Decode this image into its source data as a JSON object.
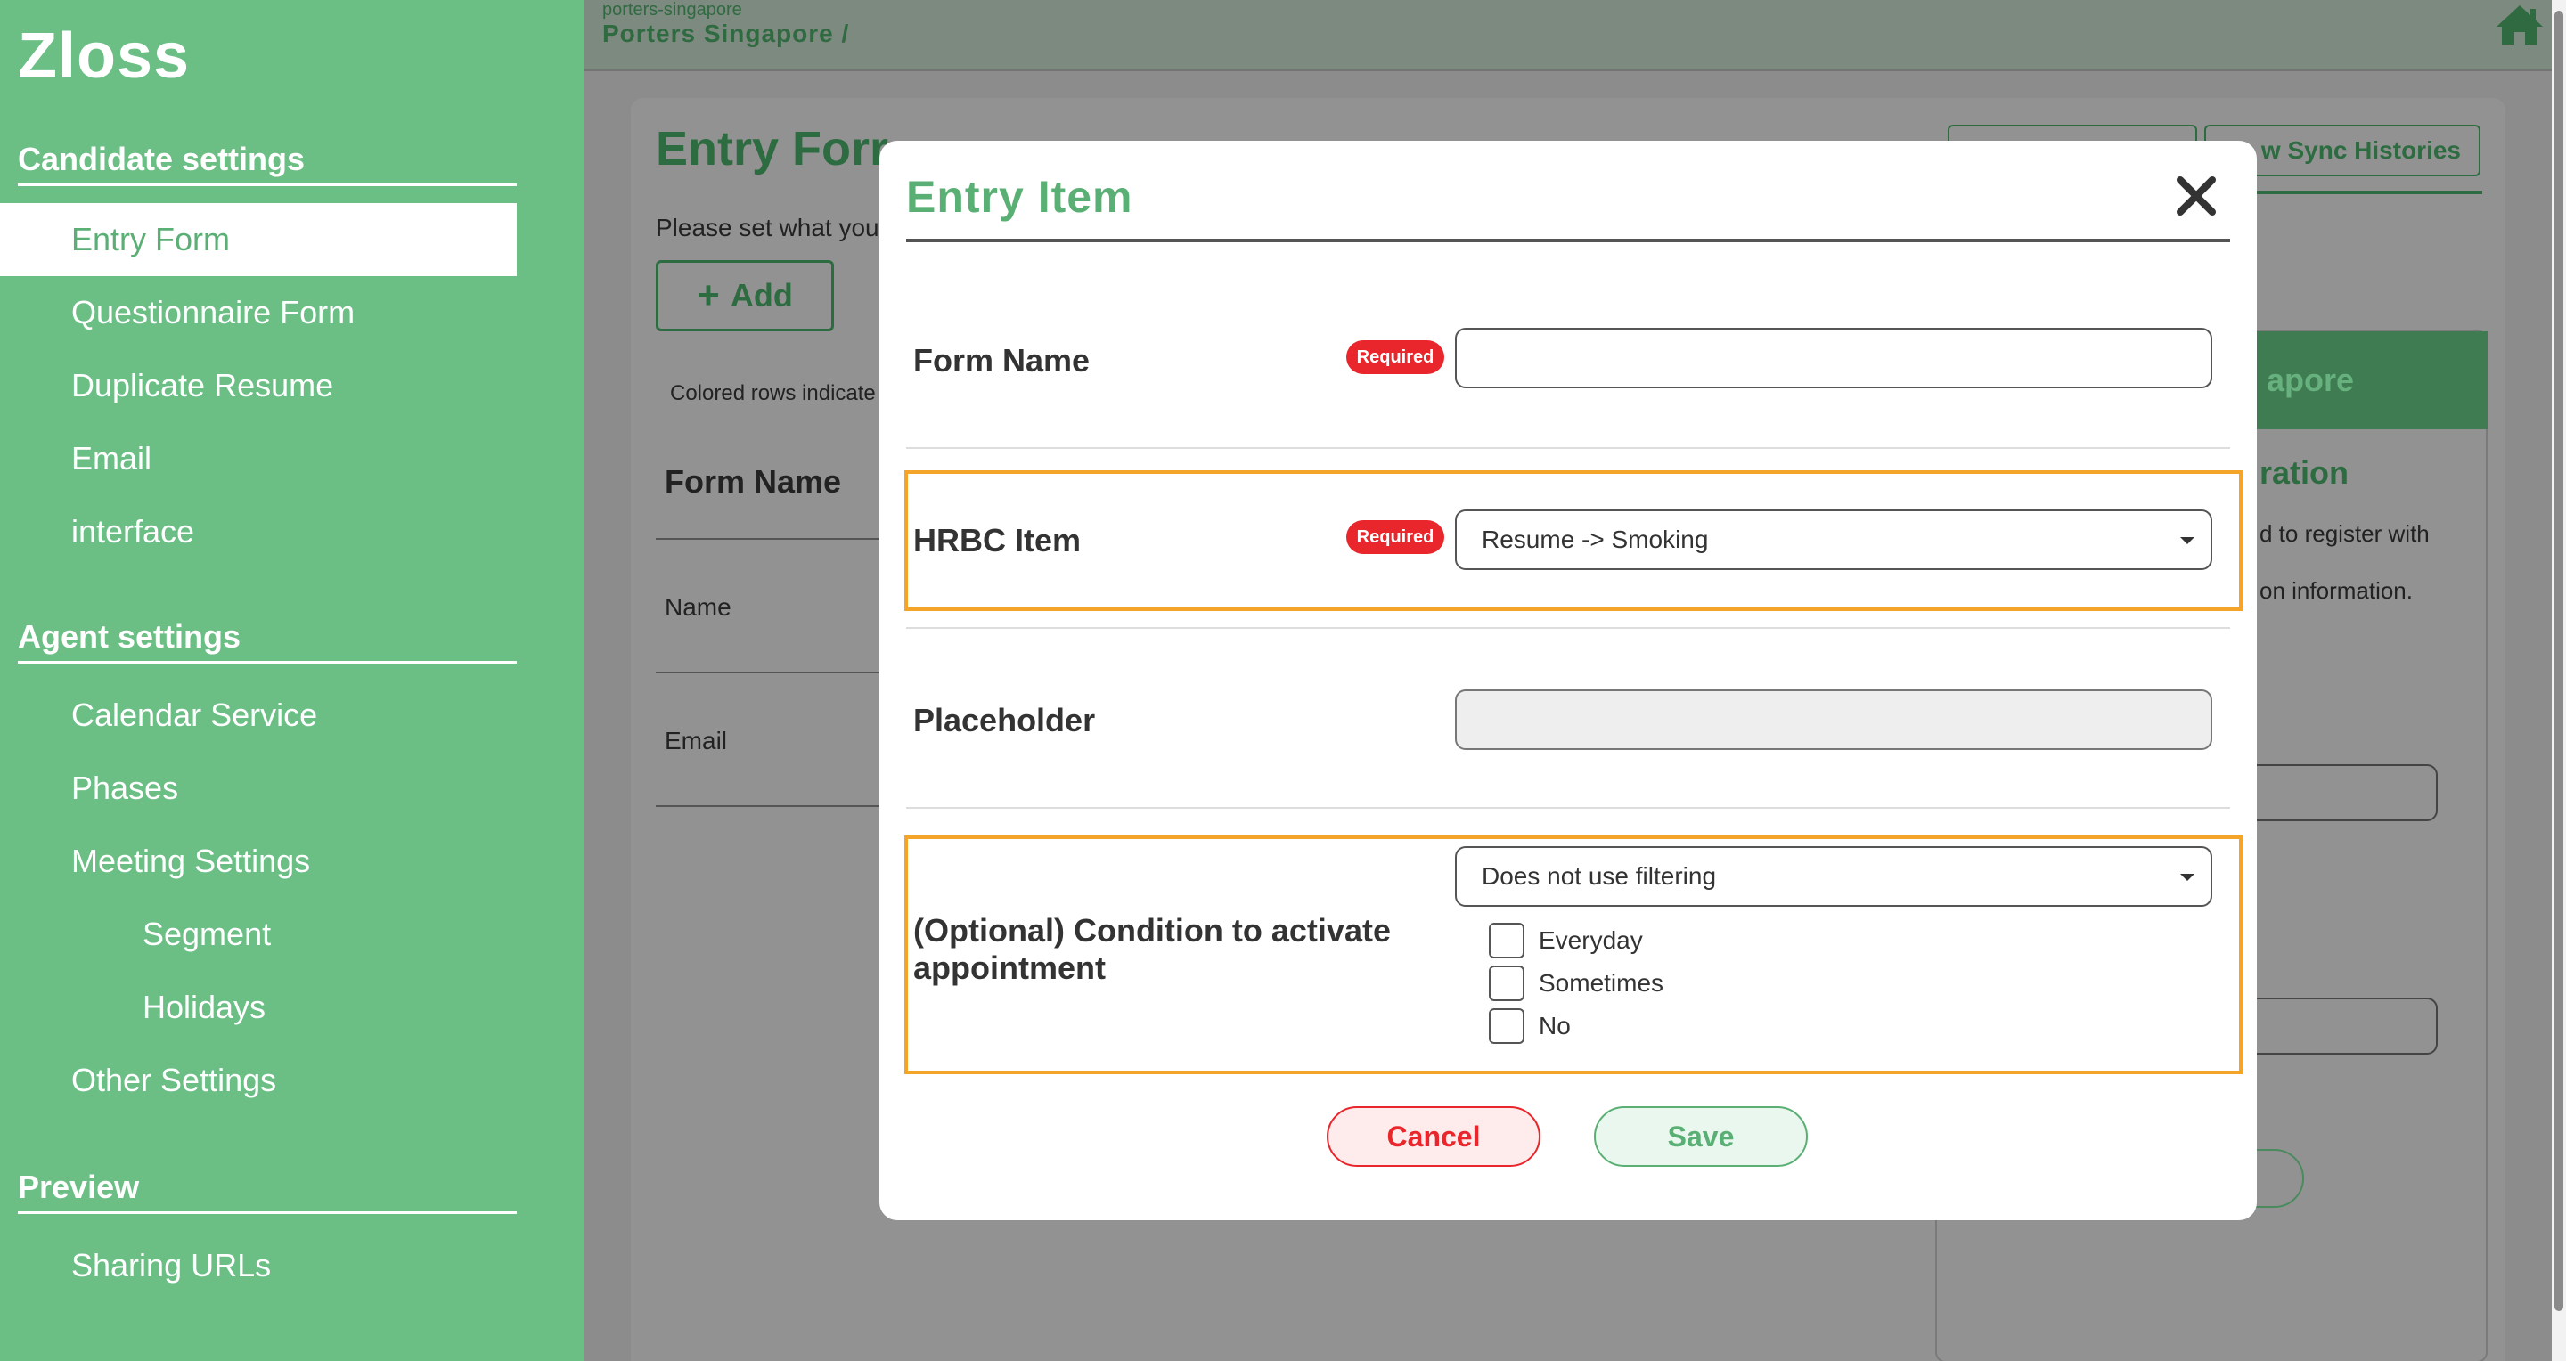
{
  "app": {
    "logo": "Zloss"
  },
  "sidebar": {
    "candidate_settings": {
      "title": "Candidate settings",
      "items": [
        {
          "label": "Entry Form"
        },
        {
          "label": "Questionnaire Form"
        },
        {
          "label": "Duplicate Resume"
        },
        {
          "label": "Email"
        },
        {
          "label": "interface"
        }
      ]
    },
    "agent_settings": {
      "title": "Agent settings",
      "items": [
        {
          "label": "Calendar Service"
        },
        {
          "label": "Phases"
        },
        {
          "label": "Meeting Settings"
        },
        {
          "label": "Segment"
        },
        {
          "label": "Holidays"
        },
        {
          "label": "Other Settings"
        }
      ]
    },
    "preview": {
      "title": "Preview",
      "items": [
        {
          "label": "Sharing URLs"
        }
      ]
    }
  },
  "header": {
    "org_slug": "porters-singapore",
    "org_name": "Porters Singapore /"
  },
  "background": {
    "title": "Entry Forr",
    "description": "Please set what you",
    "add_label": "Add",
    "note": "Colored rows indicate",
    "column_header": "Form Name",
    "rows": [
      "Name",
      "Email"
    ],
    "sync_button": "w Sync Histories",
    "card_header": "apore",
    "card_subtitle": "ration",
    "card_text_1": "d to register with",
    "card_text_2": "on information."
  },
  "modal": {
    "title": "Entry Item",
    "required_badge": "Required",
    "form_name": {
      "label": "Form Name",
      "value": "",
      "placeholder": ""
    },
    "hrbc_item": {
      "label": "HRBC Item",
      "selected": "Resume -> Smoking"
    },
    "placeholder_field": {
      "label": "Placeholder",
      "value": ""
    },
    "condition": {
      "label": "(Optional) Condition to activate appointment",
      "selected": "Does not use filtering",
      "options": [
        {
          "label": "Everyday",
          "checked": false
        },
        {
          "label": "Sometimes",
          "checked": false
        },
        {
          "label": "No",
          "checked": false
        }
      ]
    },
    "cancel_label": "Cancel",
    "save_label": "Save"
  },
  "colors": {
    "brand_green": "#6bbf85",
    "accent_green": "#5aaf74",
    "required_red": "#e8262b",
    "highlight_orange": "#f4a428"
  }
}
